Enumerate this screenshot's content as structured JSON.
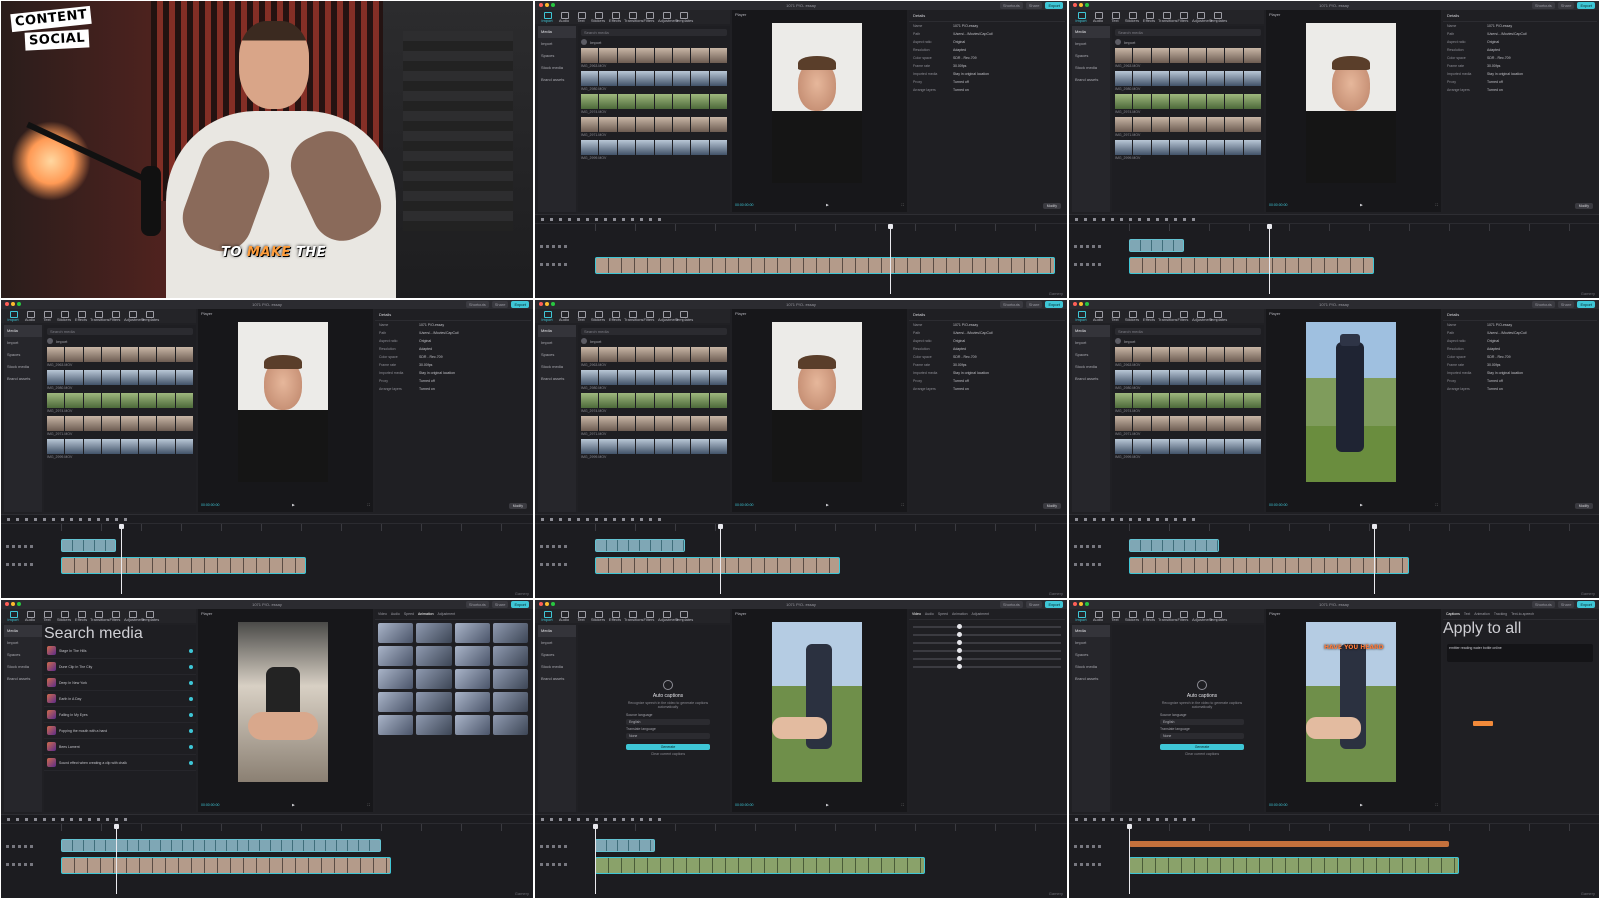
{
  "webcam": {
    "logo_line1": "CONTENT",
    "logo_line2": "SOCIAL",
    "caption_highlight": "MAKE",
    "caption_before": "TO ",
    "caption_after": " THE"
  },
  "editor": {
    "project_name": "1071 P/O- essay",
    "project_name_short": "1071P/O-ssay",
    "toolbar": [
      "Import",
      "Audio",
      "Text",
      "Stickers",
      "Effects",
      "Transitions",
      "Filters",
      "Adjustment",
      "Templates"
    ],
    "titlebar_right": [
      "Shortcuts",
      "Share",
      "Export"
    ],
    "leftnav": [
      "Media",
      "Import",
      "Spaces",
      "Stock media",
      "Brand assets"
    ],
    "search_placeholder": "Search media",
    "import_label": "Import",
    "player_label": "Player",
    "timecode_current": "00:00:00:00",
    "timecode_total": "00:00:20:14",
    "details_title": "Details",
    "details_rows": [
      {
        "k": "Name",
        "v": "1071 P/O-essay"
      },
      {
        "k": "Path",
        "v": "/Users/.../Movies/CapCut/"
      },
      {
        "k": "Aspect ratio",
        "v": "Original"
      },
      {
        "k": "Resolution",
        "v": "Adapted"
      },
      {
        "k": "Color space",
        "v": "SDR - Rec.709"
      },
      {
        "k": "Frame rate",
        "v": "30.00fps"
      },
      {
        "k": "Imported media",
        "v": "Stay in original location"
      },
      {
        "k": "Proxy",
        "v": "Turned off"
      },
      {
        "k": "Arrange layers",
        "v": "Turned on"
      }
    ],
    "modify_label": "Modify",
    "clip_names": [
      "IMG_2963.MOV",
      "IMG_2980.MOV",
      "IMG_2974.MOV",
      "IMG_2971.MOV",
      "IMG_2999.MOV"
    ],
    "watermark": "Gamery",
    "music_items": [
      "Stage In The Hills",
      "Dune Clip In The City",
      "Deep In New York",
      "Earth In A Day",
      "Falling In My Eyes",
      "Popping the mouth with a hand",
      "Bees Lament",
      "Sound effect when creating a clip with chalk"
    ],
    "effects_tabs": [
      "Video",
      "Audio",
      "Speed",
      "Animation",
      "Adjustment"
    ],
    "captions": {
      "title": "Auto captions",
      "desc": "Recognize speech in the video to generate captions automatically",
      "source_label": "Source language",
      "source_value": "English",
      "translate_label": "Translate language",
      "translate_value": "None",
      "generate_label": "Generate",
      "clear_label": "Clear current captions"
    },
    "text_panel": {
      "tabs": [
        "Captions",
        "Text",
        "Animation",
        "Tracking",
        "Text-to-speech"
      ],
      "apply_all": "Apply to all",
      "sample_text": "emitter reading water bottle online",
      "on_video_caption": "HAVE YOU HEARD"
    },
    "accent_color": "#3ec6d6"
  }
}
